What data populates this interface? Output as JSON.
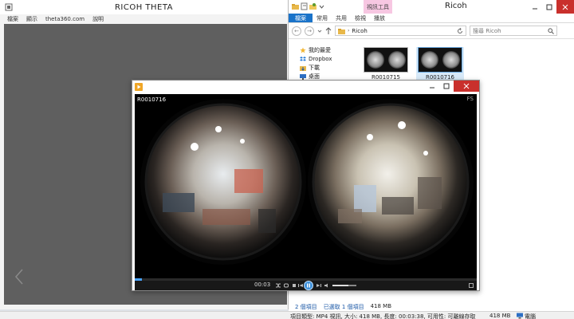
{
  "theta": {
    "title": "RICOH THETA",
    "menu": [
      "檔案",
      "顯示",
      "theta360.com",
      "說明"
    ]
  },
  "explorer": {
    "context_tab": "視訊工具",
    "title": "Ricoh",
    "ribbon_tabs": [
      "檔案",
      "常用",
      "共用",
      "檢視",
      "播放"
    ],
    "address": "Ricoh",
    "search_placeholder": "搜尋 Ricoh",
    "nav_items": [
      {
        "label": "我的最愛",
        "icon": "star-icon"
      },
      {
        "label": "Dropbox",
        "icon": "dropbox-icon"
      },
      {
        "label": "下載",
        "icon": "download-folder-icon"
      },
      {
        "label": "桌面",
        "icon": "desktop-icon"
      }
    ],
    "files": [
      {
        "name": "R0010715",
        "selected": false
      },
      {
        "name": "R0010716",
        "selected": true
      }
    ],
    "status": {
      "count": "2 個項目",
      "selected": "已選取 1 個項目",
      "size": "418 MB"
    }
  },
  "player": {
    "file_name": "R0010716",
    "fs_label": "FS",
    "time": "00:03",
    "progress": 0.02,
    "volume": 0.65
  },
  "statusbar": {
    "details": "項目類型: MP4 視訊, 大小: 418 MB, 長度: 00:03:38, 可用性: 可離線存取",
    "size": "418 MB",
    "location": "電腦"
  },
  "colors": {
    "file_tab": "#1a73c9",
    "context_tab": "#f7c7e2",
    "close_button": "#c9302c",
    "theta_canvas": "#5f5f5f"
  }
}
